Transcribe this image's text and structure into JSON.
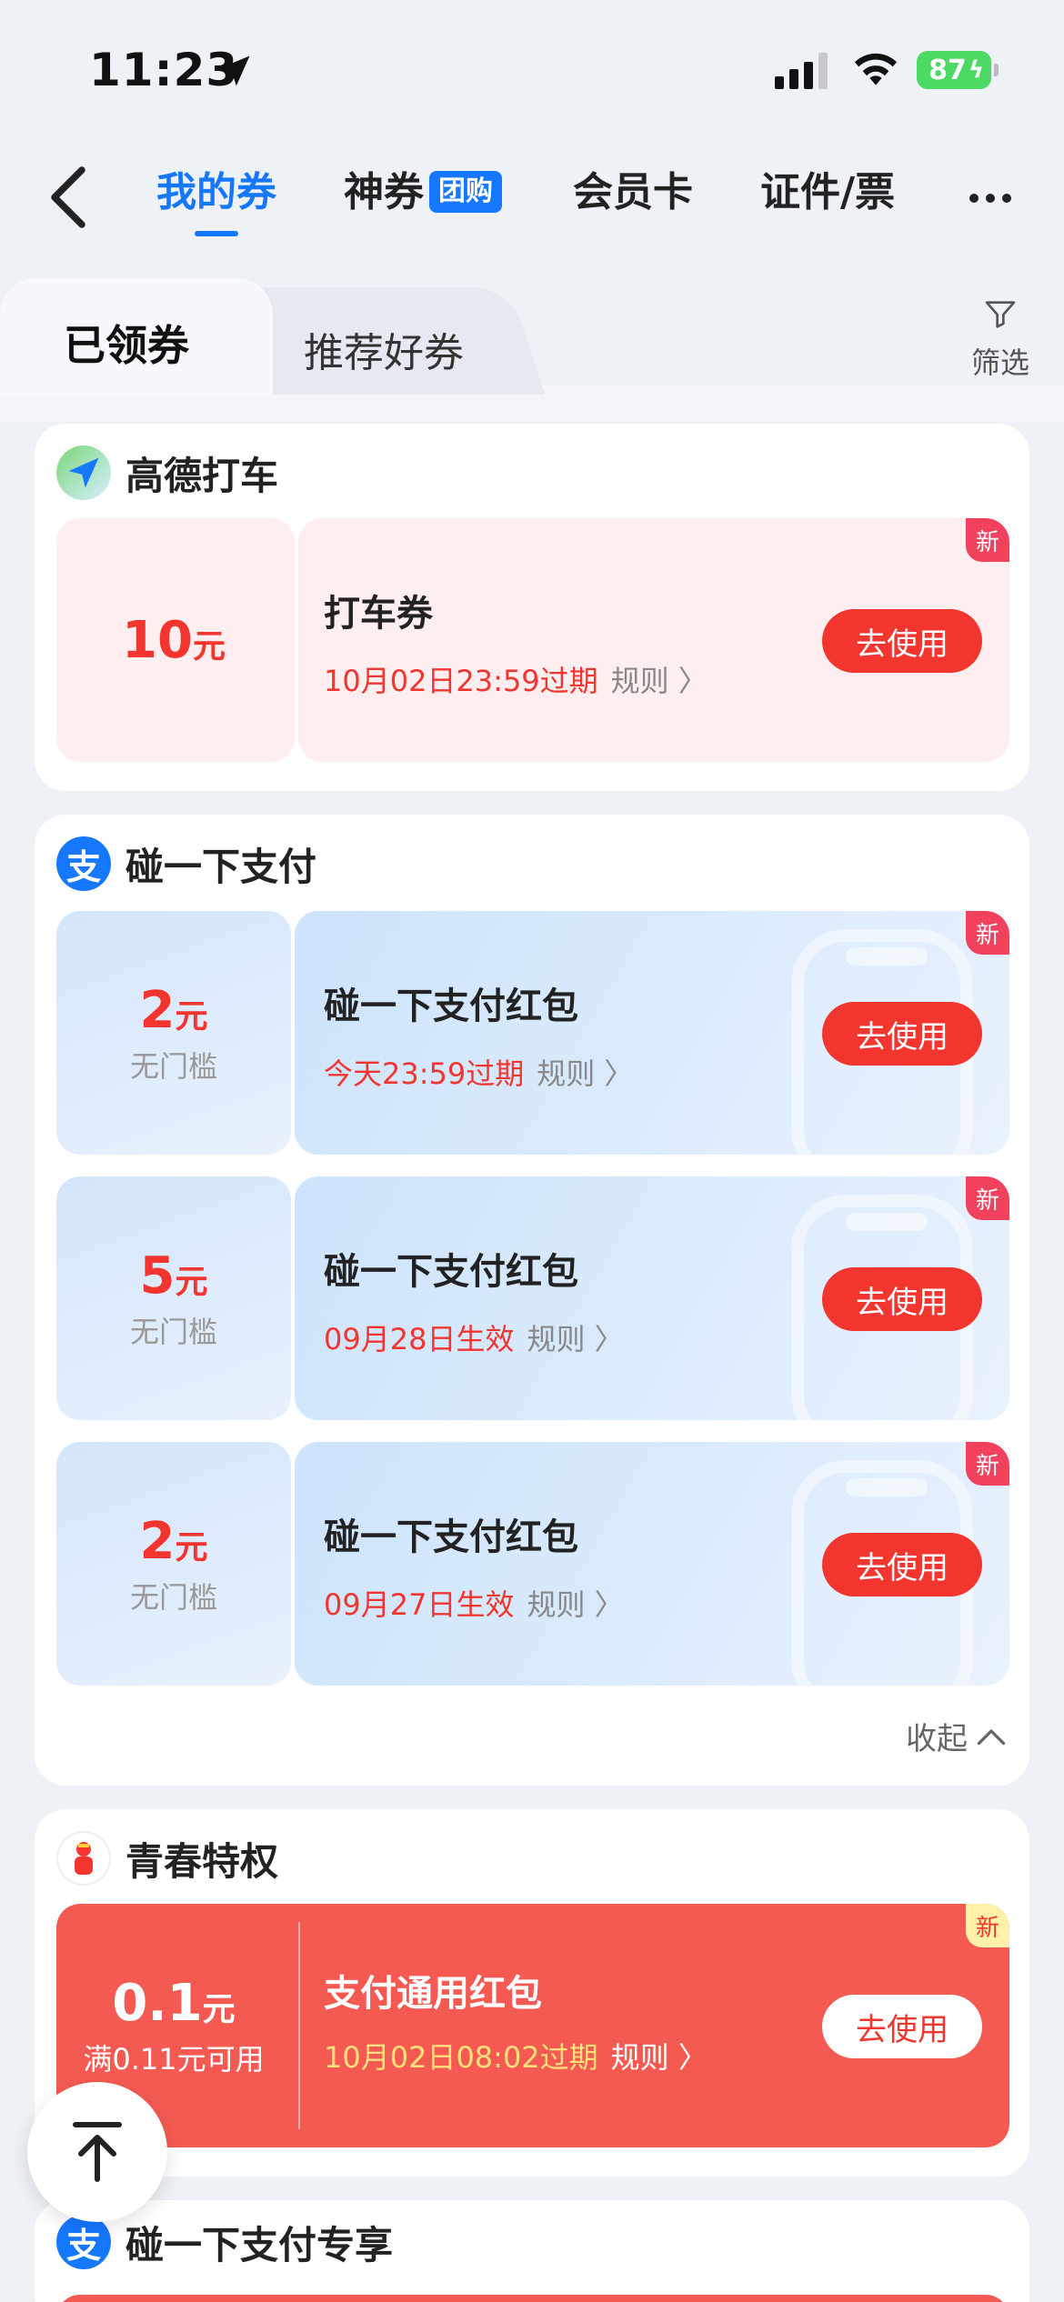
{
  "status": {
    "time": "11:23",
    "battery": "87"
  },
  "nav": {
    "tabs": [
      {
        "label": "我的券",
        "active": true
      },
      {
        "label": "神券",
        "badge": "团购"
      },
      {
        "label": "会员卡"
      },
      {
        "label": "证件/票"
      }
    ]
  },
  "subtabs": {
    "received": "已领券",
    "recommended": "推荐好券",
    "filter": "筛选"
  },
  "groups": [
    {
      "title": "高德打车",
      "coupons": [
        {
          "amount": "10",
          "unit": "元",
          "name": "打车券",
          "expiry": "10月02日23:59过期",
          "rule": "规则",
          "button": "去使用",
          "tag": "新"
        }
      ]
    },
    {
      "title": "碰一下支付",
      "coupons": [
        {
          "amount": "2",
          "unit": "元",
          "threshold": "无门槛",
          "name": "碰一下支付红包",
          "expiry": "今天23:59过期",
          "rule": "规则",
          "button": "去使用",
          "tag": "新"
        },
        {
          "amount": "5",
          "unit": "元",
          "threshold": "无门槛",
          "name": "碰一下支付红包",
          "expiry": "09月28日生效",
          "rule": "规则",
          "button": "去使用",
          "tag": "新"
        },
        {
          "amount": "2",
          "unit": "元",
          "threshold": "无门槛",
          "name": "碰一下支付红包",
          "expiry": "09月27日生效",
          "rule": "规则",
          "button": "去使用",
          "tag": "新"
        }
      ],
      "collapse": "收起"
    },
    {
      "title": "青春特权",
      "coupons": [
        {
          "amount": "0.1",
          "unit": "元",
          "threshold": "满0.11元可用",
          "name": "支付通用红包",
          "expiry": "10月02日08:02过期",
          "rule": "规则",
          "button": "去使用",
          "tag": "新"
        }
      ]
    },
    {
      "title": "碰一下支付专享"
    }
  ],
  "colors": {
    "accent": "#1677ff",
    "red": "#f2362f"
  }
}
